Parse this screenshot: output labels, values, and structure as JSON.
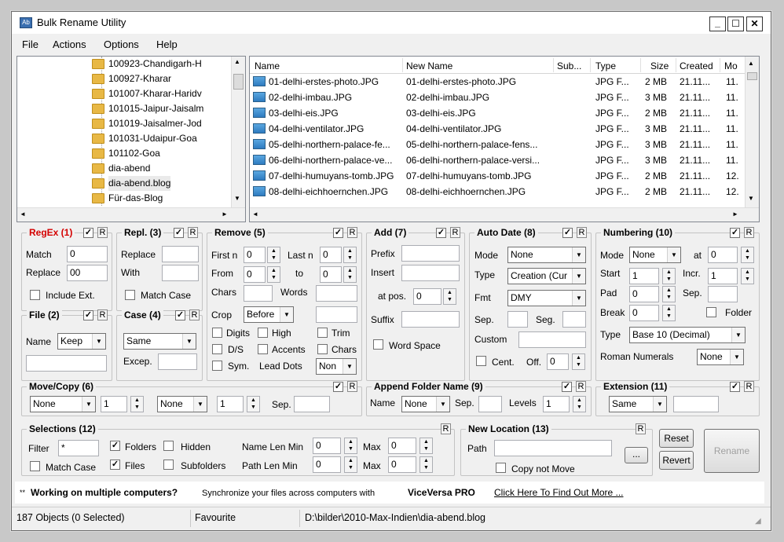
{
  "window": {
    "title": "Bulk Rename Utility",
    "minimize": "_",
    "maximize": "☐",
    "close": "✕"
  },
  "menu": [
    "File",
    "Actions",
    "Options",
    "Help"
  ],
  "tree": [
    "100923-Chandigarh-H",
    "100927-Kharar",
    "101007-Kharar-Haridv",
    "101015-Jaipur-Jaisalm",
    "101019-Jaisalmer-Jod",
    "101031-Udaipur-Goa",
    "101102-Goa",
    "dia-abend",
    "dia-abend.blog",
    "Für-das-Blog"
  ],
  "file_list": {
    "columns": [
      "Name",
      "New Name",
      "Sub...",
      "Type",
      "Size",
      "Created",
      "Mo"
    ],
    "rows": [
      [
        "01-delhi-erstes-photo.JPG",
        "01-delhi-erstes-photo.JPG",
        "",
        "JPG F...",
        "2 MB",
        "21.11...",
        "11."
      ],
      [
        "02-delhi-imbau.JPG",
        "02-delhi-imbau.JPG",
        "",
        "JPG F...",
        "3 MB",
        "21.11...",
        "11."
      ],
      [
        "03-delhi-eis.JPG",
        "03-delhi-eis.JPG",
        "",
        "JPG F...",
        "2 MB",
        "21.11...",
        "11."
      ],
      [
        "04-delhi-ventilator.JPG",
        "04-delhi-ventilator.JPG",
        "",
        "JPG F...",
        "3 MB",
        "21.11...",
        "11."
      ],
      [
        "05-delhi-northern-palace-fe...",
        "05-delhi-northern-palace-fens...",
        "",
        "JPG F...",
        "3 MB",
        "21.11...",
        "11."
      ],
      [
        "06-delhi-northern-palace-ve...",
        "06-delhi-northern-palace-versi...",
        "",
        "JPG F...",
        "3 MB",
        "21.11...",
        "11."
      ],
      [
        "07-delhi-humuyans-tomb.JPG",
        "07-delhi-humuyans-tomb.JPG",
        "",
        "JPG F...",
        "2 MB",
        "21.11...",
        "12."
      ],
      [
        "08-delhi-eichhoernchen.JPG",
        "08-delhi-eichhoernchen.JPG",
        "",
        "JPG F...",
        "2 MB",
        "21.11...",
        "12."
      ]
    ]
  },
  "regex": {
    "title": "RegEx (1)",
    "r": "R",
    "match_label": "Match",
    "match_value": "0",
    "replace_label": "Replace",
    "replace_value": "00",
    "include_ext": "Include Ext."
  },
  "repl": {
    "title": "Repl. (3)",
    "r": "R",
    "replace_label": "Replace",
    "with_label": "With",
    "match_case": "Match Case"
  },
  "file": {
    "title": "File (2)",
    "r": "R",
    "name_label": "Name",
    "name_value": "Keep"
  },
  "case": {
    "title": "Case (4)",
    "r": "R",
    "value": "Same",
    "excep_label": "Excep."
  },
  "remove": {
    "title": "Remove (5)",
    "r": "R",
    "firstn_label": "First n",
    "firstn": "0",
    "lastn_label": "Last n",
    "lastn": "0",
    "from_label": "From",
    "from": "0",
    "to_label": "to",
    "to": "0",
    "chars_label": "Chars",
    "words_label": "Words",
    "crop_label": "Crop",
    "crop_value": "Before",
    "digits": "Digits",
    "high": "High",
    "trim": "Trim",
    "ds": "D/S",
    "accents": "Accents",
    "chars2": "Chars",
    "sym": "Sym.",
    "lead_dots": "Lead Dots",
    "lead_value": "Non"
  },
  "add": {
    "title": "Add (7)",
    "r": "R",
    "prefix": "Prefix",
    "insert": "Insert",
    "atpos": "at pos.",
    "atpos_value": "0",
    "suffix": "Suffix",
    "word_space": "Word Space"
  },
  "autodate": {
    "title": "Auto Date (8)",
    "r": "R",
    "mode_label": "Mode",
    "mode_value": "None",
    "type_label": "Type",
    "type_value": "Creation (Cur",
    "fmt_label": "Fmt",
    "fmt_value": "DMY",
    "sep_label": "Sep.",
    "seg_label": "Seg.",
    "custom_label": "Custom",
    "cent": "Cent.",
    "off_label": "Off.",
    "off_value": "0"
  },
  "numbering": {
    "title": "Numbering (10)",
    "r": "R",
    "mode_label": "Mode",
    "mode_value": "None",
    "at_label": "at",
    "at_value": "0",
    "start_label": "Start",
    "start_value": "1",
    "incr_label": "Incr.",
    "incr_value": "1",
    "pad_label": "Pad",
    "pad_value": "0",
    "sep_label": "Sep.",
    "break_label": "Break",
    "break_value": "0",
    "folder": "Folder",
    "type_label": "Type",
    "type_value": "Base 10 (Decimal)",
    "roman_label": "Roman Numerals",
    "roman_value": "None"
  },
  "movecopy": {
    "title": "Move/Copy (6)",
    "r": "R",
    "sel1": "None",
    "num1": "1",
    "sel2": "None",
    "num2": "1",
    "sep_label": "Sep."
  },
  "appendfolder": {
    "title": "Append Folder Name (9)",
    "r": "R",
    "name_label": "Name",
    "name_value": "None",
    "sep_label": "Sep.",
    "levels_label": "Levels",
    "levels_value": "1"
  },
  "extension": {
    "title": "Extension (11)",
    "r": "R",
    "value": "Same"
  },
  "selections": {
    "title": "Selections (12)",
    "r": "R",
    "filter_label": "Filter",
    "filter_value": "*",
    "folders": "Folders",
    "hidden": "Hidden",
    "namelen_label": "Name Len Min",
    "namelen_min": "0",
    "max_label": "Max",
    "namelen_max": "0",
    "match_case": "Match Case",
    "files": "Files",
    "subfolders": "Subfolders",
    "pathlen_label": "Path Len Min",
    "pathlen_min": "0",
    "max2_label": "Max",
    "pathlen_max": "0"
  },
  "newlocation": {
    "title": "New Location (13)",
    "r": "R",
    "path_label": "Path",
    "browse": "...",
    "copy_not_move": "Copy not Move"
  },
  "buttons": {
    "reset": "Reset",
    "revert": "Revert",
    "rename": "Rename"
  },
  "promo": {
    "stars": "**",
    "bold1": "Working on multiple computers?",
    "text": "Synchronize your files across computers with",
    "bold2": "ViceVersa PRO",
    "link": "Click Here To Find Out More ..."
  },
  "status": {
    "objects": "187 Objects (0 Selected)",
    "favourite": "Favourite",
    "path": "D:\\bilder\\2010-Max-Indien\\dia-abend.blog"
  }
}
